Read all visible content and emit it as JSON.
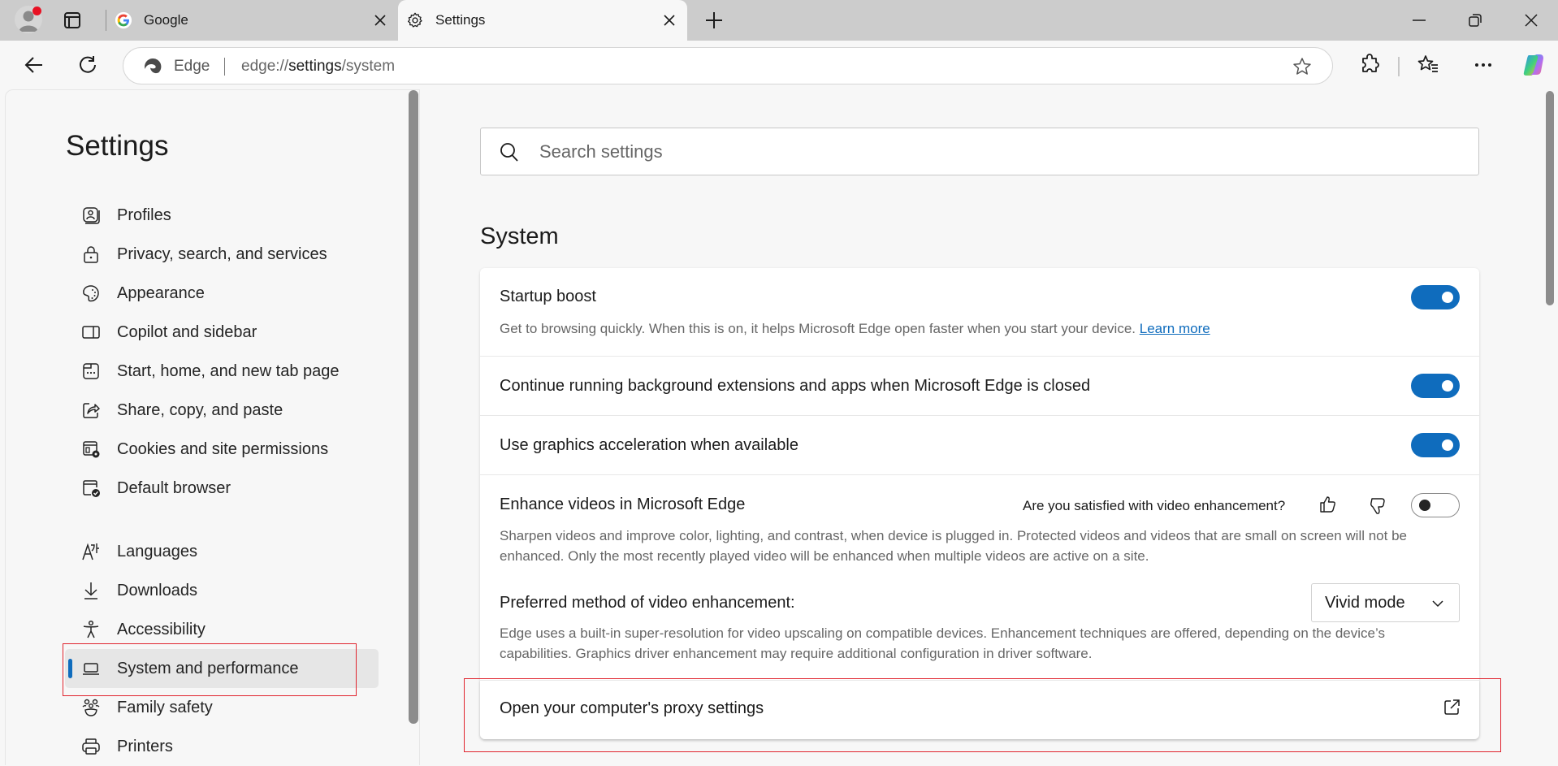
{
  "browser": {
    "tabs": [
      {
        "title": "Google",
        "favicon": "google-g-icon",
        "active": false
      },
      {
        "title": "Settings",
        "favicon": "gear-icon",
        "active": true
      }
    ],
    "address_bar": {
      "site_label": "Edge",
      "url_prefix": "edge://",
      "url_bold": "settings",
      "url_suffix": "/system"
    },
    "colors": {
      "accent": "#0f6cbd",
      "tabstrip": "#cccccc",
      "highlight_box": "#e0242e"
    }
  },
  "sidebar": {
    "title": "Settings",
    "items": [
      {
        "label": "Profiles",
        "icon": "profile-icon"
      },
      {
        "label": "Privacy, search, and services",
        "icon": "lock-icon"
      },
      {
        "label": "Appearance",
        "icon": "palette-icon"
      },
      {
        "label": "Copilot and sidebar",
        "icon": "sidebar-panel-icon"
      },
      {
        "label": "Start, home, and new tab page",
        "icon": "home-page-icon"
      },
      {
        "label": "Share, copy, and paste",
        "icon": "share-icon"
      },
      {
        "label": "Cookies and site permissions",
        "icon": "cookie-settings-icon"
      },
      {
        "label": "Default browser",
        "icon": "default-browser-icon"
      },
      {
        "label": "Languages",
        "icon": "languages-icon"
      },
      {
        "label": "Downloads",
        "icon": "download-icon"
      },
      {
        "label": "Accessibility",
        "icon": "accessibility-icon"
      },
      {
        "label": "System and performance",
        "icon": "laptop-icon",
        "selected": true
      },
      {
        "label": "Family safety",
        "icon": "family-icon"
      },
      {
        "label": "Printers",
        "icon": "printer-icon"
      }
    ]
  },
  "main": {
    "search": {
      "placeholder": "Search settings",
      "value": ""
    },
    "section_title": "System",
    "settings": {
      "startup_boost": {
        "title": "Startup boost",
        "description": "Get to browsing quickly. When this is on, it helps Microsoft Edge open faster when you start your device.",
        "link": "Learn more",
        "enabled": true
      },
      "background_extensions": {
        "title": "Continue running background extensions and apps when Microsoft Edge is closed",
        "enabled": true
      },
      "graphics_acceleration": {
        "title": "Use graphics acceleration when available",
        "enabled": true
      },
      "enhance_videos": {
        "title": "Enhance videos in Microsoft Edge",
        "feedback_question": "Are you satisfied with video enhancement?",
        "description": "Sharpen videos and improve color, lighting, and contrast, when device is plugged in. Protected videos and videos that are small on screen will not be enhanced. Only the most recently played video will be enhanced when multiple videos are active on a site.",
        "enabled": false
      },
      "enhancement_method": {
        "title": "Preferred method of video enhancement:",
        "selected": "Vivid mode",
        "description": "Edge uses a built-in super-resolution for video upscaling on compatible devices. Enhancement techniques are offered, depending on the device’s capabilities. Graphics driver enhancement may require additional configuration in driver software."
      },
      "proxy": {
        "title": "Open your computer's proxy settings"
      }
    }
  }
}
